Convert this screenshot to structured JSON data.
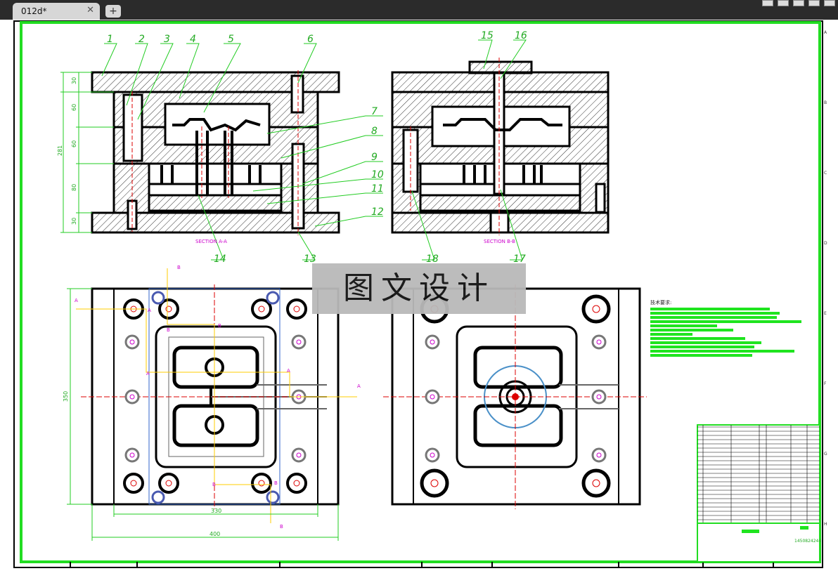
{
  "tab": {
    "label": "012d*",
    "close": "✕",
    "add": "+"
  },
  "watermark": "图文设计",
  "tech_notes_title": "技术要求:",
  "section_labels": {
    "a": "SECTION A-A",
    "b": "SECTION B-B"
  },
  "part_numbers": [
    "1",
    "2",
    "3",
    "4",
    "5",
    "6",
    "7",
    "8",
    "9",
    "10",
    "11",
    "12",
    "13",
    "14",
    "15",
    "16",
    "17",
    "18"
  ],
  "dimensions": {
    "heights": [
      "30",
      "60",
      "60",
      "80",
      "30"
    ],
    "total_height": "281",
    "plate_height": "350",
    "inner_width": "330",
    "outer_width": "400"
  },
  "cut_markers": [
    "A",
    "A",
    "A",
    "A",
    "A",
    "B",
    "B",
    "B",
    "B",
    "B",
    "B"
  ],
  "border_letters_right": [
    "A",
    "B",
    "C",
    "D",
    "E",
    "F",
    "G",
    "H"
  ],
  "title_block": {
    "drawing_no": "1450824244"
  },
  "colors": {
    "border": "#22dd22",
    "outline": "#000000",
    "center_line": "#dd0000",
    "dim": "#22cc22",
    "section": "#ff00ff",
    "cut_line": "#ffcc00"
  }
}
